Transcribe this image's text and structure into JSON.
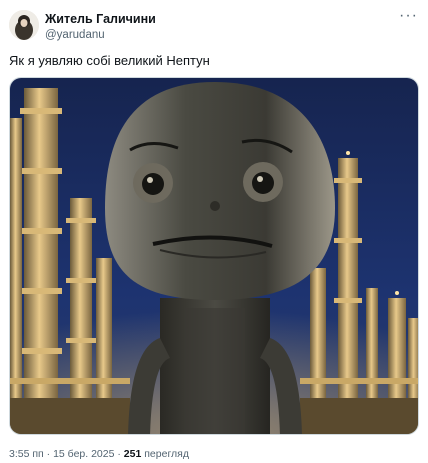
{
  "author": {
    "name": "Житель Галичини",
    "handle": "@yarudanu"
  },
  "more_icon": "more-horizontal-icon",
  "post": {
    "text": "Як я уявляю собі великий Нептун"
  },
  "media": {
    "type": "image",
    "description": "Large cartoon robot head with worried face standing among industrial refinery towers at night"
  },
  "meta": {
    "time": "3:55 пп",
    "separator": "·",
    "date": "15 бер. 2025",
    "separator2": "·",
    "views": "251",
    "views_label": "перегляд"
  },
  "colors": {
    "text": "#0f1419",
    "secondary": "#536471",
    "border": "#cfd9de",
    "sky": "#1a2a5a"
  }
}
